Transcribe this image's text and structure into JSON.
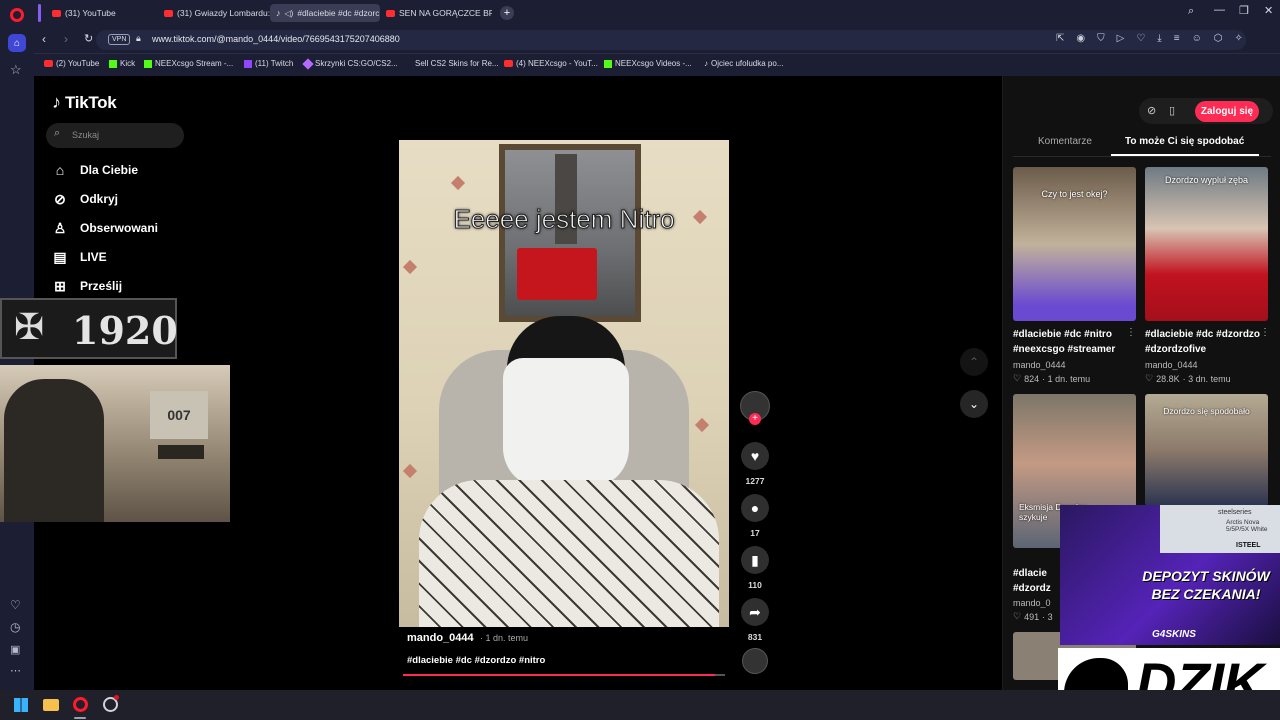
{
  "tabs": [
    {
      "label": "(31) YouTube",
      "icon": "youtube-icon"
    },
    {
      "label": "(31) Gwiazdy Lombardu: G",
      "icon": "youtube-icon"
    },
    {
      "label": "#dlaciebie #dc #dzorc",
      "icon": "tiktok-icon",
      "active": true
    },
    {
      "label": "SEN NA GORĄCZCE BRAC",
      "icon": "youtube-icon"
    }
  ],
  "address": {
    "vpn": "VPN",
    "url": "www.tiktok.com/@mando_0444/video/7669543175207406880"
  },
  "bookmarks": [
    {
      "label": "(2) YouTube",
      "icon": "youtube-icon"
    },
    {
      "label": "Kick",
      "icon": "kick-icon"
    },
    {
      "label": "NEEXcsgo Stream -...",
      "icon": "kick-icon"
    },
    {
      "label": "(11) Twitch",
      "icon": "twitch-icon"
    },
    {
      "label": "Skrzynki CS:GO/CS2...",
      "icon": "case-icon"
    },
    {
      "label": "Sell CS2 Skins for Re...",
      "icon": "skins-icon"
    },
    {
      "label": "(4) NEEXcsgo - YouT...",
      "icon": "youtube-icon"
    },
    {
      "label": "NEEXcsgo Videos -...",
      "icon": "kick-icon"
    },
    {
      "label": "Ojciec ufoludka po...",
      "icon": "tiktok-icon"
    }
  ],
  "tiktok": {
    "logo": "TikTok",
    "search_placeholder": "Szukaj",
    "nav": [
      {
        "label": "Dla Ciebie",
        "icon": "home-icon"
      },
      {
        "label": "Odkryj",
        "icon": "compass-icon"
      },
      {
        "label": "Obserwowani",
        "icon": "following-icon"
      },
      {
        "label": "LIVE",
        "icon": "live-icon"
      },
      {
        "label": "Prześlij",
        "icon": "upload-icon"
      }
    ],
    "login": "Zaloguj się",
    "panel_tabs": {
      "comments": "Komentarze",
      "recommended": "To może Ci się spodobać"
    }
  },
  "video": {
    "caption_overlay": "Eeeee jestem Nitro",
    "author": "mando_0444",
    "age": "· 1 dn. temu",
    "hashtags": "#dlaciebie #dc #dzordzo #nitro",
    "likes": "1277",
    "comments": "17",
    "saves": "110",
    "shares": "831",
    "progress": 0.97
  },
  "cards": [
    {
      "title": "#dlaciebie #dc #nitro #neexcsgo #streamer",
      "author": "mando_0444",
      "likes": "824",
      "age": "· 1 dn. temu",
      "overlay": "Czy to jest okej?"
    },
    {
      "title": "#dlaciebie #dc #dzordzo #dzordzofive",
      "author": "mando_0444",
      "likes": "28.8K",
      "age": "· 3 dn. temu",
      "overlay": "Dzordzo wypluł zęba"
    },
    {
      "title": "#dlacie",
      "title2": "#dzordz",
      "author": "mando_0",
      "likes": "491",
      "age": "· 3",
      "overlay": "Eksmisja Dzordzo szykuje"
    },
    {
      "title": "",
      "author": "",
      "likes": "",
      "age": "",
      "overlay": "Dzordzo się spodobało"
    }
  ],
  "stream": {
    "badge": "1920",
    "poster": "007",
    "ad_headline": "DEPOZYT SKINÓW BEZ CZEKANIA!",
    "ad_brand": "G4SKINS",
    "ad_product": "Arctis Nova 5/5P/5X White",
    "ad_shop": "steelseries",
    "ad_tag": "ISTEEL",
    "sponsor": "DZIK"
  },
  "colors": {
    "brand": "#fe2c55",
    "browser": "#1c1f33",
    "page": "#000000"
  }
}
